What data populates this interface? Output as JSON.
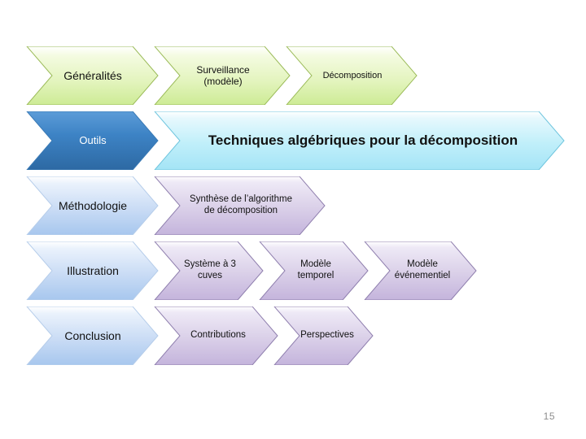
{
  "slide": {
    "page_number": "15",
    "rows": [
      {
        "id": "row-generalites",
        "label": "Généralités",
        "segments": [
          {
            "label": "Surveillance\n(modèle)"
          },
          {
            "label": "Décomposition"
          }
        ]
      },
      {
        "id": "row-outils",
        "label": "Outils",
        "segments": [
          {
            "label": "Techniques algébriques pour la décomposition"
          }
        ]
      },
      {
        "id": "row-methodologie",
        "label": "Méthodologie",
        "segments": [
          {
            "label": "Synthèse de l’algorithme\nde décomposition"
          }
        ]
      },
      {
        "id": "row-illustration",
        "label": "Illustration",
        "segments": [
          {
            "label": "Système à 3\ncuves"
          },
          {
            "label": "Modèle\ntemporel"
          },
          {
            "label": "Modèle\névénementiel"
          }
        ]
      },
      {
        "id": "row-conclusion",
        "label": "Conclusion",
        "segments": [
          {
            "label": "Contributions"
          },
          {
            "label": "Perspectives"
          }
        ]
      }
    ]
  },
  "colors": {
    "green": "#cdeb95",
    "green_border": "#9bbb59",
    "blue_dark": "#3c82c4",
    "cyan": "#bdeef9",
    "blue_pale": "#c6daf4",
    "violet": "#d9cfe8",
    "violet_border": "#8f7fae",
    "page_number": "#8d8d8d"
  }
}
